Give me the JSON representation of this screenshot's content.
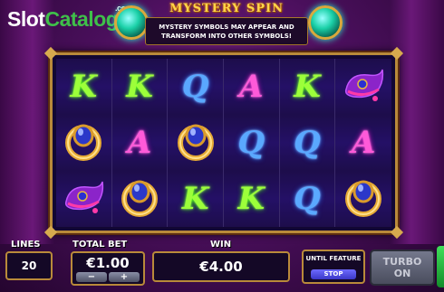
{
  "watermark": {
    "slot": "Slot",
    "catalog": "Catalog",
    "com": ".com"
  },
  "header": {
    "title": "MYSTERY SPIN",
    "banner_line1": "MYSTERY SYMBOLS MAY APPEAR AND",
    "banner_line2": "TRANSFORM INTO OTHER SYMBOLS!"
  },
  "reels": [
    [
      "K",
      "K",
      "Q",
      "A",
      "K",
      "slipper"
    ],
    [
      "ring",
      "A",
      "ring",
      "Q",
      "Q",
      "A"
    ],
    [
      "slipper",
      "ring",
      "K",
      "K",
      "Q",
      "ring"
    ]
  ],
  "controls": {
    "lines_label": "LINES",
    "lines_value": "20",
    "total_bet_label": "TOTAL BET",
    "total_bet_value": "€1.00",
    "bet_minus": "−",
    "bet_plus": "+",
    "win_label": "WIN",
    "win_value": "€4.00",
    "until_feature": "UNTIL FEATURE",
    "stop_label": "STOP",
    "turbo_line1": "TURBO",
    "turbo_line2": "ON"
  },
  "colors": {
    "k_symbol": "#9cff3a",
    "q_symbol": "#5aa8ff",
    "a_symbol": "#ff5ad9",
    "frame_gold": "#b98a3a"
  }
}
